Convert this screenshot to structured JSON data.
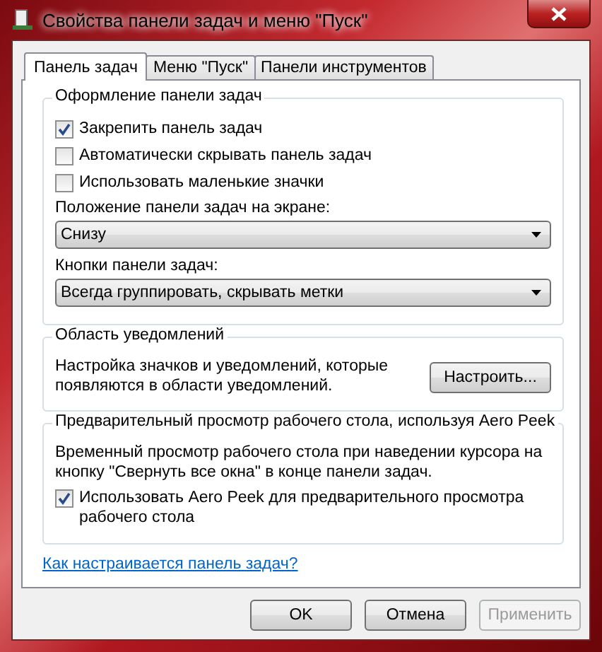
{
  "window": {
    "title": "Свойства панели задач и меню \"Пуск\""
  },
  "tabs": [
    {
      "label": "Панель задач",
      "selected": true
    },
    {
      "label": "Меню \"Пуск\"",
      "selected": false
    },
    {
      "label": "Панели инструментов",
      "selected": false
    }
  ],
  "groups": [
    {
      "title": "Оформление панели задач",
      "items": [
        {
          "kind": "checkbox",
          "label": "Закрепить панель задач",
          "checked": true
        },
        {
          "kind": "checkbox",
          "label": "Автоматически скрывать панель задач",
          "checked": false
        },
        {
          "kind": "checkbox",
          "label": "Использовать маленькие значки",
          "checked": false
        },
        {
          "kind": "dropdown",
          "label": "Положение панели задач на экране:",
          "value": "Снизу"
        },
        {
          "kind": "dropdown",
          "label": "Кнопки панели задач:",
          "value": "Всегда группировать, скрывать метки"
        }
      ]
    },
    {
      "title": "Область уведомлений",
      "items": [
        {
          "kind": "text_button",
          "text": "Настройка значков и уведомлений, которые появляются в области уведомлений.",
          "button": "Настроить..."
        }
      ]
    },
    {
      "title": "Предварительный просмотр рабочего стола, используя Aero Peek",
      "items": [
        {
          "kind": "text",
          "text": "Временный просмотр рабочего стола при наведении курсора на кнопку \"Свернуть все окна\" в конце панели задач."
        },
        {
          "kind": "checkbox",
          "label": "Использовать Aero Peek для предварительного просмотра рабочего стола",
          "checked": true
        }
      ]
    }
  ],
  "help_link": "Как настраивается панель задач?",
  "buttons": [
    {
      "label": "OK",
      "disabled": false
    },
    {
      "label": "Отмена",
      "disabled": false
    },
    {
      "label": "Применить",
      "disabled": true
    }
  ]
}
